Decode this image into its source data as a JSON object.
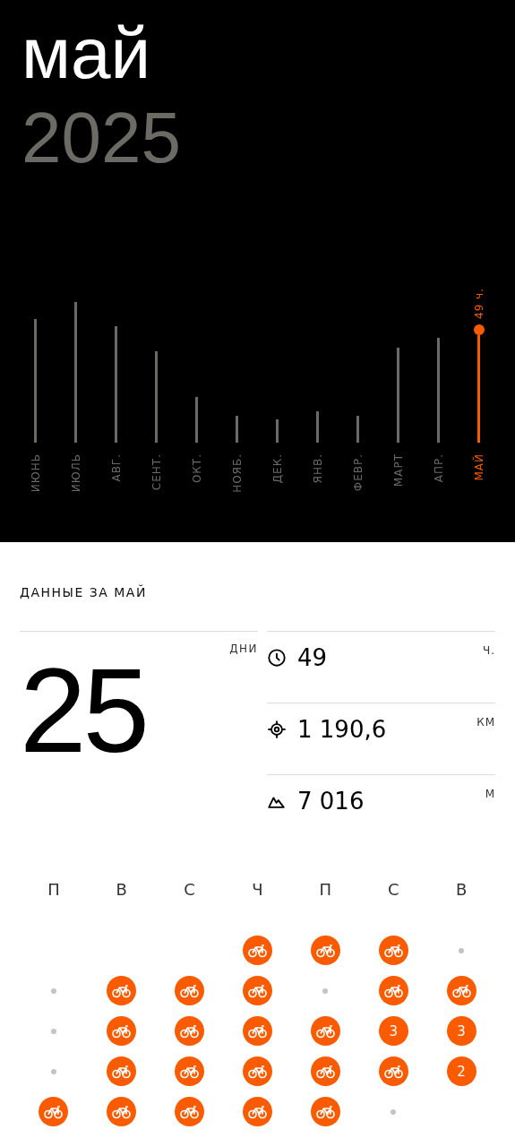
{
  "header": {
    "month": "май",
    "year": "2025"
  },
  "months": [
    {
      "label": "ИЮНЬ",
      "selected": false
    },
    {
      "label": "ИЮЛЬ",
      "selected": false
    },
    {
      "label": "АВГ.",
      "selected": false
    },
    {
      "label": "СЕНТ.",
      "selected": false
    },
    {
      "label": "ОКТ.",
      "selected": false
    },
    {
      "label": "НОЯБ.",
      "selected": false
    },
    {
      "label": "ДЕК.",
      "selected": false
    },
    {
      "label": "ЯНВ.",
      "selected": false
    },
    {
      "label": "ФЕВР.",
      "selected": false
    },
    {
      "label": "МАРТ",
      "selected": false
    },
    {
      "label": "АПР.",
      "selected": false
    },
    {
      "label": "МАЙ",
      "selected": true,
      "value": "49 ч."
    }
  ],
  "summary": {
    "title": "ДАННЫЕ ЗА МАЙ",
    "days": {
      "value": "25",
      "unit": "ДНИ"
    },
    "stats": [
      {
        "kind": "time",
        "value": "49",
        "unit": "Ч."
      },
      {
        "kind": "distance",
        "value": "1 190,6",
        "unit": "КМ"
      },
      {
        "kind": "elevation",
        "value": "7 016",
        "unit": "М"
      }
    ]
  },
  "calendar": {
    "weekdays": [
      "П",
      "В",
      "С",
      "Ч",
      "П",
      "С",
      "В"
    ],
    "weeks": [
      [
        {
          "kind": "empty"
        },
        {
          "kind": "empty"
        },
        {
          "kind": "empty"
        },
        {
          "kind": "ride"
        },
        {
          "kind": "ride"
        },
        {
          "kind": "ride"
        },
        {
          "kind": "rest"
        }
      ],
      [
        {
          "kind": "rest"
        },
        {
          "kind": "ride"
        },
        {
          "kind": "ride"
        },
        {
          "kind": "ride"
        },
        {
          "kind": "rest"
        },
        {
          "kind": "ride"
        },
        {
          "kind": "ride"
        }
      ],
      [
        {
          "kind": "rest"
        },
        {
          "kind": "ride"
        },
        {
          "kind": "ride"
        },
        {
          "kind": "ride"
        },
        {
          "kind": "ride"
        },
        {
          "kind": "count",
          "count": "3"
        },
        {
          "kind": "count",
          "count": "3"
        }
      ],
      [
        {
          "kind": "rest"
        },
        {
          "kind": "ride"
        },
        {
          "kind": "ride"
        },
        {
          "kind": "ride"
        },
        {
          "kind": "ride"
        },
        {
          "kind": "ride"
        },
        {
          "kind": "count",
          "count": "2"
        }
      ],
      [
        {
          "kind": "ride"
        },
        {
          "kind": "ride"
        },
        {
          "kind": "ride"
        },
        {
          "kind": "ride"
        },
        {
          "kind": "ride"
        },
        {
          "kind": "rest"
        },
        {
          "kind": "empty"
        }
      ]
    ]
  }
}
